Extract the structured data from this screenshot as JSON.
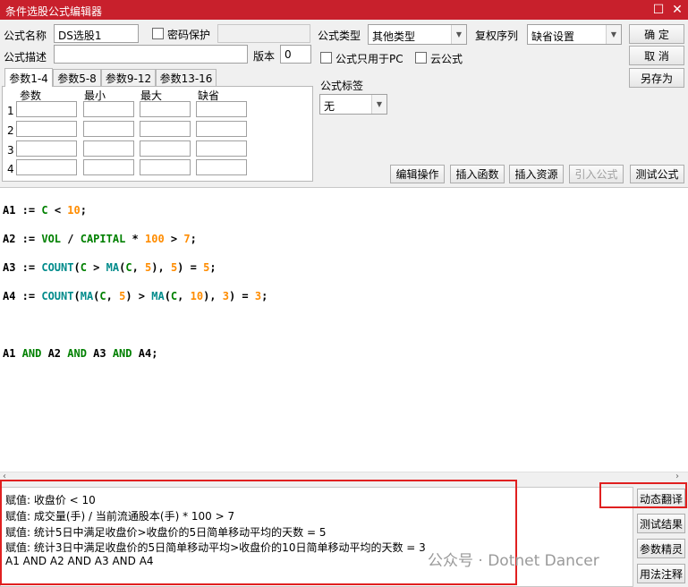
{
  "window": {
    "title": "条件选股公式编辑器"
  },
  "form": {
    "name_label": "公式名称",
    "name_value": "DS选股1",
    "password_label": "密码保护",
    "desc_label": "公式描述",
    "desc_value": "",
    "version_label": "版本",
    "version_value": "0",
    "type_label": "公式类型",
    "type_value": "其他类型",
    "rights_label": "复权序列",
    "rights_value": "缺省设置",
    "pc_only_label": "公式只用于PC",
    "cloud_label": "云公式",
    "tag_label": "公式标签",
    "tag_value": "无"
  },
  "buttons": {
    "ok": "确  定",
    "cancel": "取  消",
    "save_as": "另存为",
    "edit_ops": "编辑操作",
    "insert_fn": "插入函数",
    "insert_res": "插入资源",
    "import_formula": "引入公式",
    "test_formula": "测试公式",
    "dynamic_translate": "动态翻译",
    "test_result": "测试结果",
    "param_tune": "参数精灵",
    "usage_notes": "用法注释"
  },
  "tabs": [
    "参数1-4",
    "参数5-8",
    "参数9-12",
    "参数13-16"
  ],
  "params": {
    "headers": [
      "参数",
      "最小",
      "最大",
      "缺省"
    ],
    "rows": [
      "1",
      "2",
      "3",
      "4"
    ]
  },
  "code": {
    "l1": {
      "a": "A1",
      "b": " := ",
      "c": "C",
      "d": " < ",
      "e": "10",
      "f": ";"
    },
    "l2": {
      "a": "A2",
      "b": " := ",
      "c": "VOL",
      "d": " / ",
      "e": "CAPITAL",
      "f": " * ",
      "g": "100",
      "h": " > ",
      "i": "7",
      "j": ";"
    },
    "l3": {
      "a": "A3",
      "b": " := ",
      "c": "COUNT",
      "d": "(",
      "e": "C",
      "f": " > ",
      "g": "MA",
      "h": "(",
      "i": "C",
      "j": ", ",
      "k": "5",
      "l": "), ",
      "m": "5",
      "n": ") = ",
      "o": "5",
      "p": ";"
    },
    "l4": {
      "a": "A4",
      "b": " := ",
      "c": "COUNT",
      "d": "(",
      "e": "MA",
      "f": "(",
      "g": "C",
      "h": ", ",
      "i": "5",
      "j": ") > ",
      "k": "MA",
      "l": "(",
      "m": "C",
      "n": ", ",
      "o": "10",
      "p": "), ",
      "q": "3",
      "r": ") = ",
      "s": "3",
      "t": ";"
    },
    "l6": {
      "a": "A1",
      "b": " AND ",
      "c": "A2",
      "d": " AND ",
      "e": "A3",
      "f": " AND ",
      "g": "A4",
      "h": ";"
    }
  },
  "translation": [
    "赋值: 收盘价 < 10",
    "赋值: 成交量(手) / 当前流通股本(手) * 100 > 7",
    "赋值: 统计5日中满足收盘价>收盘价的5日简单移动平均的天数 = 5",
    "赋值: 统计3日中满足收盘价的5日简单移动平均>收盘价的10日简单移动平均的天数 = 3",
    " A1 AND A2 AND A3 AND A4"
  ],
  "watermark": "公众号 · Dotnet Dancer",
  "colors": {
    "titlebar": "#c8202c",
    "highlight": "#e02020",
    "keyword": "#008000",
    "function": "#008b8b",
    "number": "#ff8c00"
  }
}
